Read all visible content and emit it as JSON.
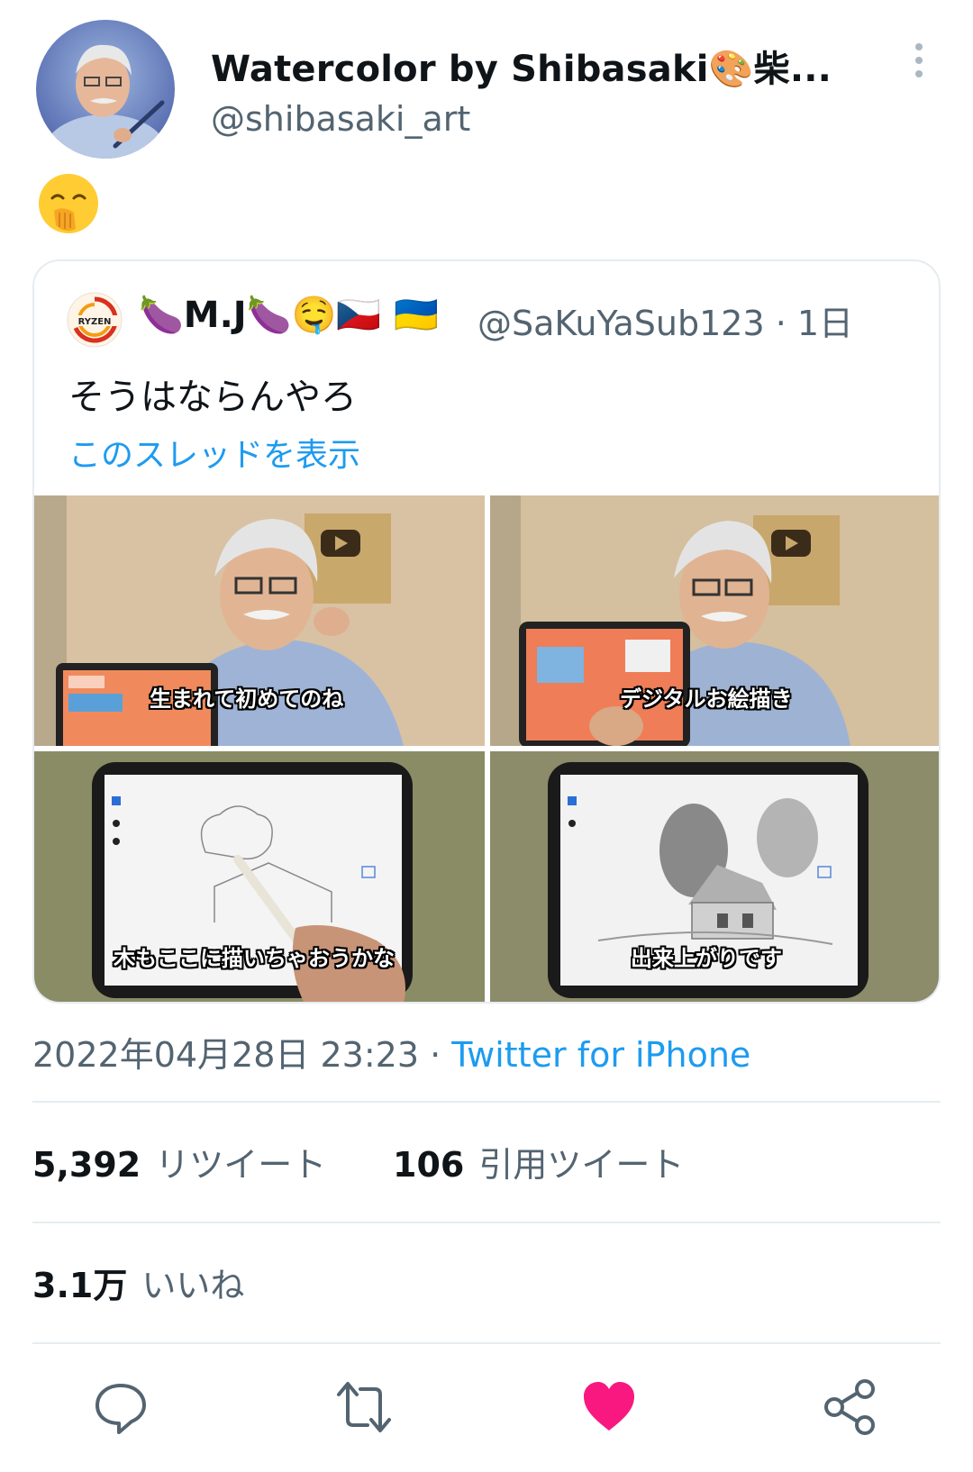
{
  "header": {
    "display_name": "Watercolor by Shibasaki🎨柴...",
    "handle": "@shibasaki_art"
  },
  "tweet": {
    "body_emoji": "🤭"
  },
  "quote": {
    "name_parts": [
      "🍆",
      "M.J",
      "🍆",
      "🤤",
      "🇨🇿",
      "🇺🇦"
    ],
    "name_display": "🍆M.J🍆🤤🇨🇿 🇺🇦",
    "handle_time": "@SaKuYaSub123 · 1日",
    "text": "そうはならんやろ",
    "thread_link": "このスレッドを表示",
    "avatar_text": "RYZEN",
    "media": [
      {
        "caption": "生まれて初めてのね",
        "icon": "play-icon"
      },
      {
        "caption": "デジタルお絵描き",
        "icon": "play-icon"
      },
      {
        "caption": "木もここに描いちゃおうかな"
      },
      {
        "caption": "出来上がりです"
      }
    ]
  },
  "meta": {
    "timestamp": "2022年04月28日 23:23 · ",
    "source": "Twitter for iPhone"
  },
  "stats": {
    "retweets_count": "5,392",
    "retweets_label": "リツイート",
    "quotes_count": "106",
    "quotes_label": "引用ツイート",
    "likes_count": "3.1万",
    "likes_label": "いいね"
  },
  "actions": {
    "reply": "reply-icon",
    "retweet": "retweet-icon",
    "like": "heart-icon",
    "share": "share-icon"
  },
  "colors": {
    "link": "#1d9bf0",
    "secondary": "#536471",
    "like": "#f91880",
    "divider": "#e6ecf0"
  }
}
